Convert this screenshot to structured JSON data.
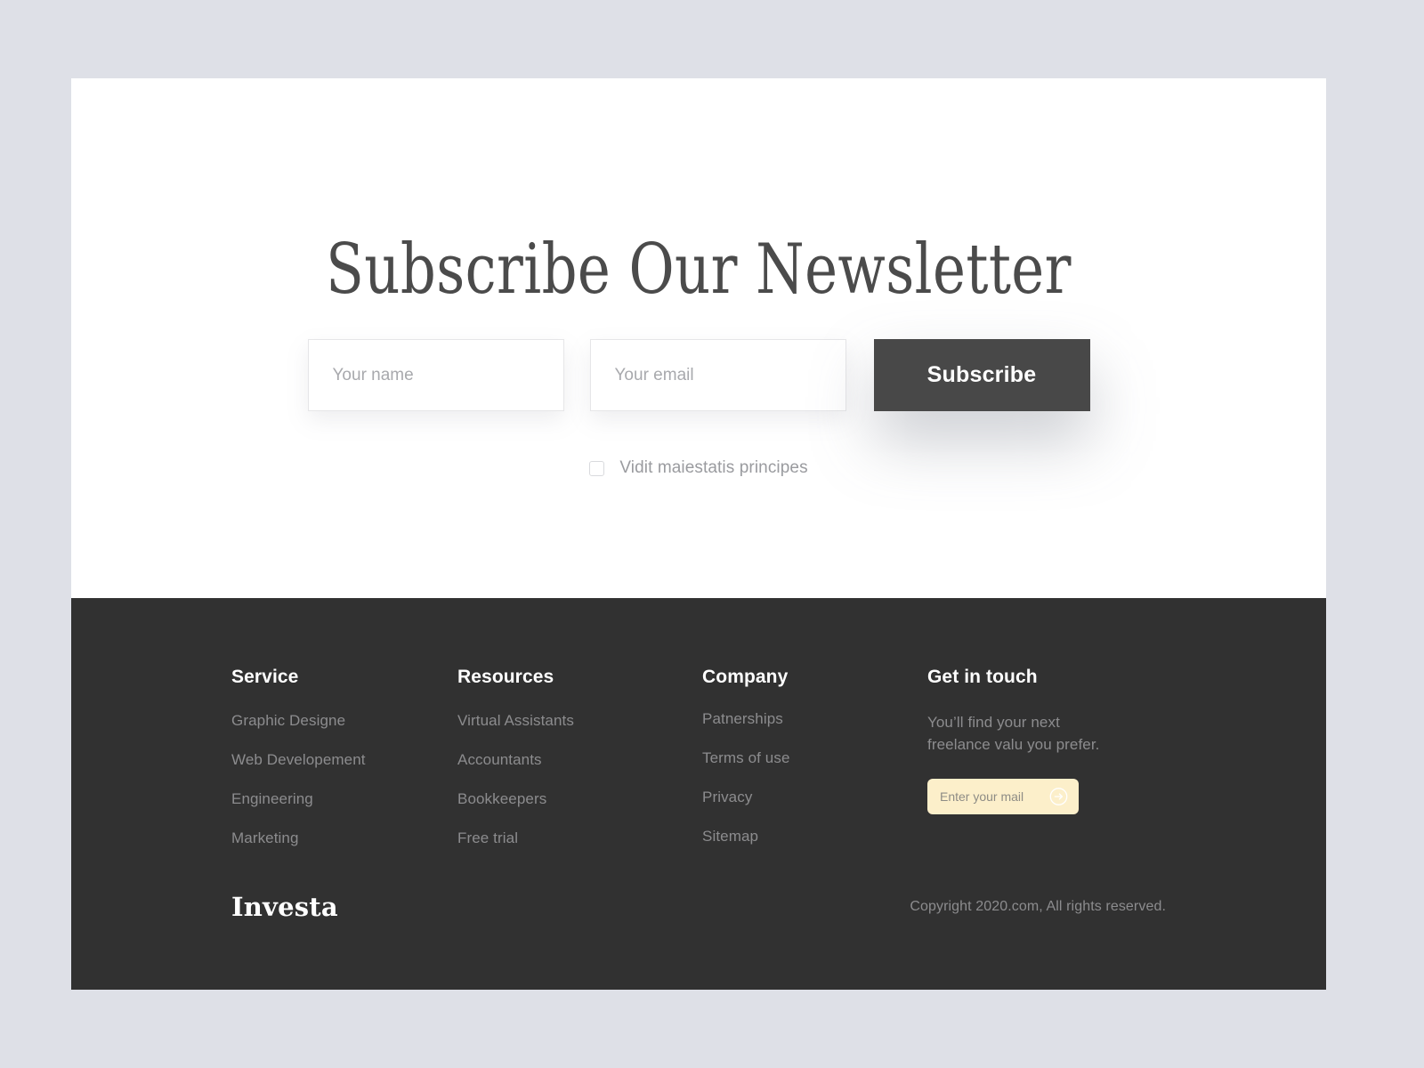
{
  "colors": {
    "page_background": "#dee0e7",
    "card_background": "#ffffff",
    "footer_background": "#313131",
    "button_dark": "#484848",
    "accent_cream": "#fcefca",
    "heading_text": "#4b4b4b",
    "muted_link": "#8c8c8e"
  },
  "newsletter": {
    "title": "Subscribe Our Newsletter",
    "name_field": {
      "value": "",
      "placeholder": "Your name"
    },
    "email_field": {
      "value": "",
      "placeholder": "Your email"
    },
    "subscribe_label": "Subscribe",
    "consent": {
      "label": "Vidit maiestatis principes",
      "checked": false
    }
  },
  "footer": {
    "columns": [
      {
        "title": "Service",
        "links": [
          "Graphic Designe",
          "Web Developement",
          "Engineering",
          "Marketing"
        ]
      },
      {
        "title": "Resources",
        "links": [
          "Virtual Assistants",
          "Accountants",
          "Bookkeepers",
          "Free trial"
        ]
      },
      {
        "title": "Company",
        "links": [
          "Patnerships",
          "Terms of use",
          "Privacy",
          "Sitemap"
        ]
      }
    ],
    "contact": {
      "title": "Get in touch",
      "description": "You’ll find your next freelance valu you prefer.",
      "mail_field": {
        "value": "",
        "placeholder": "Enter your mail"
      },
      "submit_icon": "arrow-right-circle-icon"
    },
    "brand": "Investa",
    "copyright": "Copyright 2020.com, All rights reserved."
  }
}
